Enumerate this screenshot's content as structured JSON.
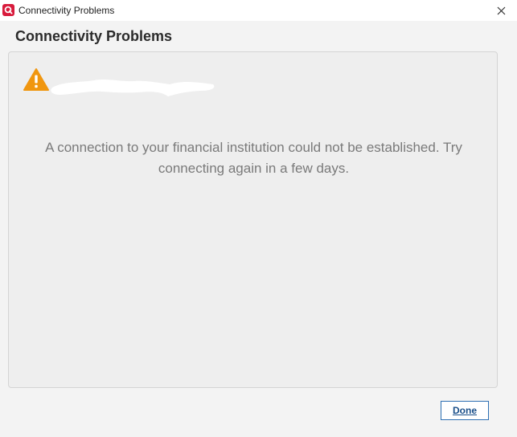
{
  "window": {
    "title": "Connectivity Problems",
    "app_icon": "quicken-logo-icon",
    "close_icon": "close-icon"
  },
  "dialog": {
    "heading": "Connectivity Problems",
    "warning_icon": "warning-icon",
    "institution_name": "",
    "message": "A connection to your financial institution could not be established. Try connecting again in a few days.",
    "done_label": "Done"
  },
  "colors": {
    "app_icon_bg": "#d81b3c",
    "warning": "#f0960f",
    "button_border": "#2d6fb3",
    "message_text": "#7a7a7a"
  }
}
